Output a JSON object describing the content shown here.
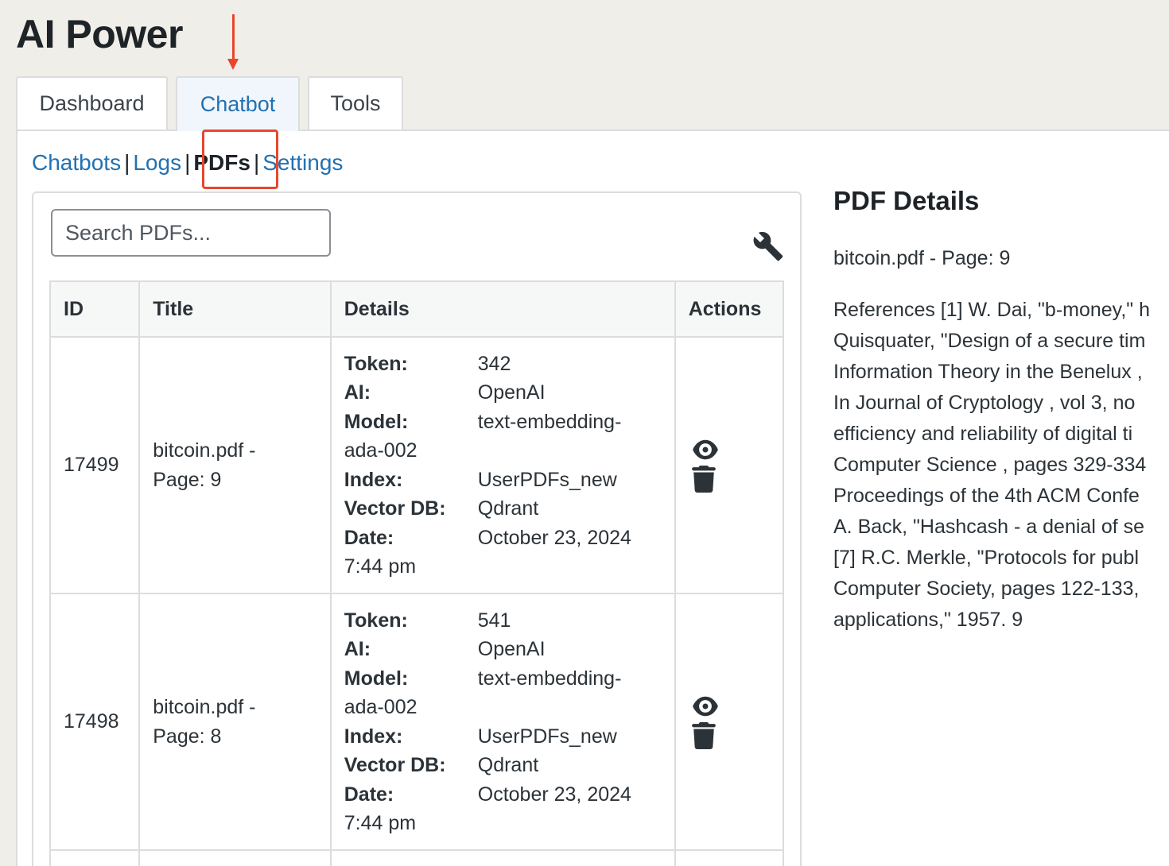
{
  "app": {
    "title": "AI Power"
  },
  "tabs": [
    {
      "label": "Dashboard",
      "active": false
    },
    {
      "label": "Chatbot",
      "active": true
    },
    {
      "label": "Tools",
      "active": false
    }
  ],
  "subnav": {
    "items": [
      "Chatbots",
      "Logs",
      "PDFs",
      "Settings"
    ],
    "separator": "|",
    "current": "PDFs"
  },
  "search": {
    "placeholder": "Search PDFs..."
  },
  "table": {
    "headers": {
      "id": "ID",
      "title": "Title",
      "details": "Details",
      "actions": "Actions"
    },
    "detail_labels": {
      "token": "Token:",
      "ai": "AI:",
      "model": "Model:",
      "index": "Index:",
      "vector_db": "Vector DB:",
      "date": "Date:"
    },
    "rows": [
      {
        "id": "17499",
        "title_line1": "bitcoin.pdf -",
        "title_line2": "Page: 9",
        "token": "342",
        "ai": "OpenAI",
        "model_line1": "text-embedding-",
        "model_line2": "ada-002",
        "index": "UserPDFs_new",
        "vector_db": "Qdrant",
        "date": "October 23, 2024",
        "time": "7:44 pm"
      },
      {
        "id": "17498",
        "title_line1": "bitcoin.pdf -",
        "title_line2": "Page: 8",
        "token": "541",
        "ai": "OpenAI",
        "model_line1": "text-embedding-",
        "model_line2": "ada-002",
        "index": "UserPDFs_new",
        "vector_db": "Qdrant",
        "date": "October 23, 2024",
        "time": "7:44 pm"
      }
    ]
  },
  "pdf_details": {
    "title": "PDF Details",
    "subtitle": "bitcoin.pdf - Page: 9",
    "body": "References [1] W. Dai, \"b-money,\" h\nQuisquater, \"Design of a secure tim\nInformation Theory in the Benelux ,\nIn Journal of Cryptology , vol 3, no\nefficiency and reliability of digital ti\nComputer Science , pages 329-334\nProceedings of the 4th ACM Confe\nA. Back, \"Hashcash - a denial of se\n[7] R.C. Merkle, \"Protocols for publ\nComputer Society, pages 122-133,\napplications,\" 1957. 9"
  },
  "colors": {
    "accent": "#2271b1",
    "annotation": "#e8472c",
    "background": "#f0eee8"
  },
  "icons": {
    "view": "eye-icon",
    "delete": "trash-icon",
    "settings": "wrench-icon"
  }
}
